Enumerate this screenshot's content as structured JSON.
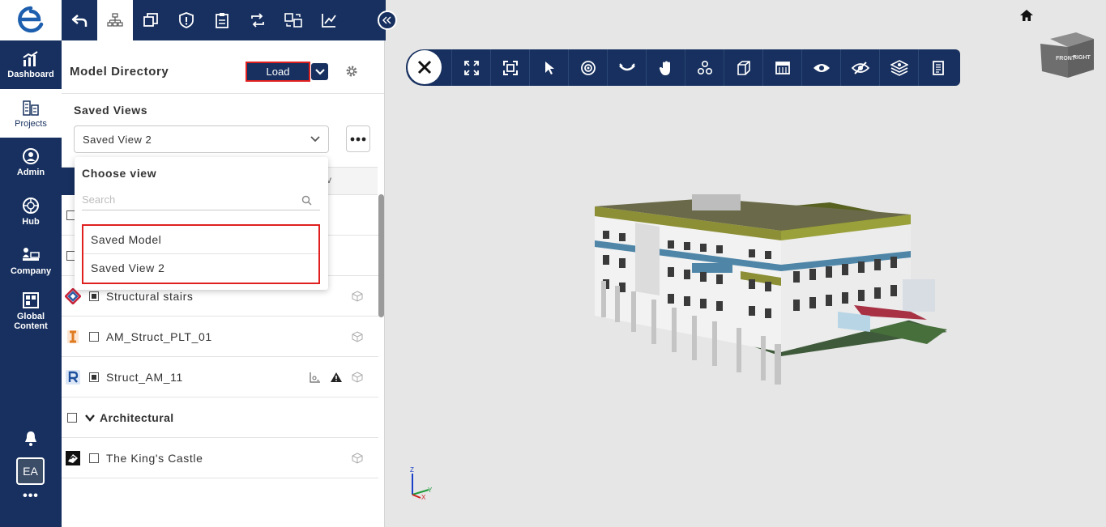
{
  "nav": {
    "items": [
      {
        "label": "Dashboard",
        "icon": "chart-icon"
      },
      {
        "label": "Projects",
        "icon": "buildings-icon"
      },
      {
        "label": "Admin",
        "icon": "admin-icon"
      },
      {
        "label": "Hub",
        "icon": "hub-icon"
      },
      {
        "label": "Company",
        "icon": "company-icon"
      },
      {
        "label": "Global Content",
        "icon": "global-content-icon"
      }
    ],
    "avatar": "EA",
    "more": "•••"
  },
  "panel": {
    "title": "Model Directory",
    "load_label": "Load",
    "saved_views_label": "Saved Views",
    "selected_view": "Saved View 2",
    "tab_tail": "v"
  },
  "dropdown": {
    "title": "Choose view",
    "search_placeholder": "Search",
    "options": [
      "Saved Model",
      "Saved View 2"
    ]
  },
  "models": [
    {
      "name": "Structural stairs",
      "app": "navisworks"
    },
    {
      "name": "AM_Struct_PLT_01",
      "app": "ifc"
    },
    {
      "name": "Struct_AM_11",
      "app": "revit",
      "has_warning": true
    },
    {
      "group": "Architectural"
    },
    {
      "name": "The King's Castle",
      "app": "sketchup"
    }
  ],
  "viewer": {
    "viewcube_front": "FRONT",
    "viewcube_right": "RIGHT",
    "axis_z": "Z",
    "axis_y": "Y",
    "axis_x": "X"
  },
  "colors": {
    "navy": "#17305f",
    "highlight": "#e0201f"
  }
}
